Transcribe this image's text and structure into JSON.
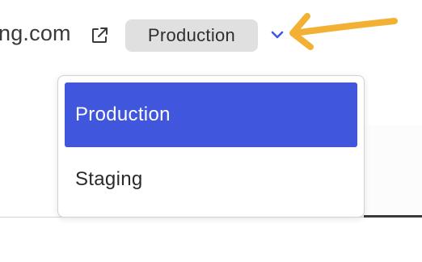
{
  "header": {
    "domain_text": "ng.com",
    "environment_badge": "Production"
  },
  "dropdown": {
    "options": [
      {
        "label": "Production",
        "selected": true
      },
      {
        "label": "Staging",
        "selected": false
      }
    ]
  },
  "icons": {
    "external_link": "external-link-icon",
    "chevron": "chevron-down-icon",
    "annotation_arrow": "annotation-arrow-icon"
  },
  "colors": {
    "selected_bg": "#3f56dd",
    "selected_text": "#ffffff",
    "badge_bg": "#e0e0e0",
    "chevron": "#3f56dd",
    "annotation_arrow": "#f2b134"
  }
}
